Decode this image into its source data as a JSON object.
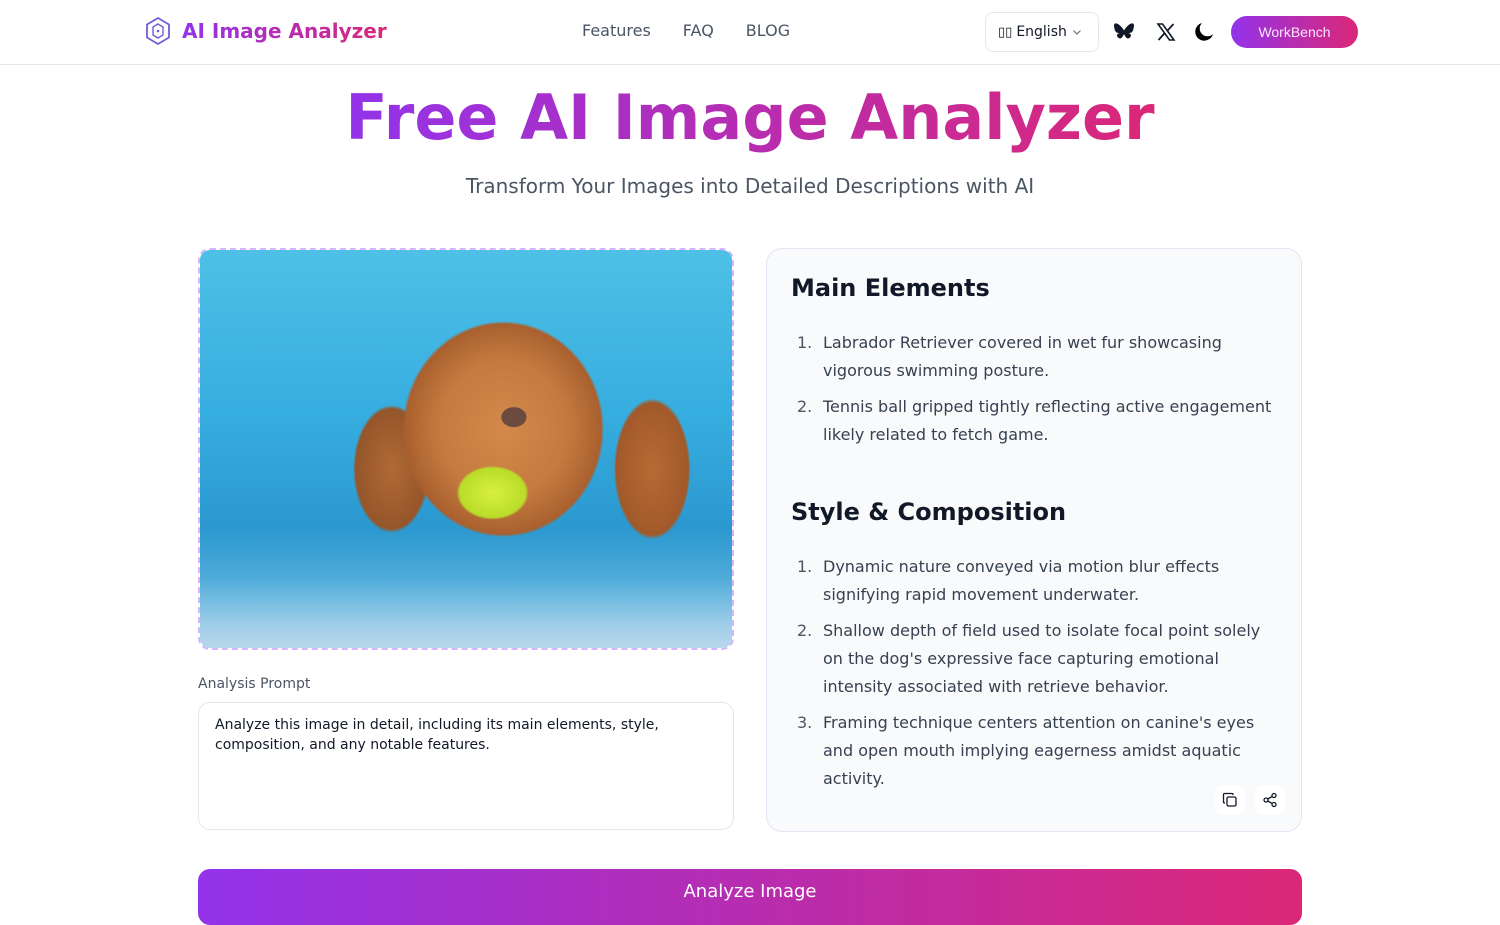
{
  "header": {
    "brand": "AI Image Analyzer",
    "nav": [
      {
        "label": "Features"
      },
      {
        "label": "FAQ"
      },
      {
        "label": "BLOG"
      }
    ],
    "language": {
      "flag": "🇺🇸",
      "selected": "English"
    },
    "icons": [
      "bluesky-icon",
      "x-icon",
      "moon-icon"
    ],
    "workbench_label": "WorkBench"
  },
  "hero": {
    "title": "Free AI Image Analyzer",
    "subtitle": "Transform Your Images into Detailed Descriptions with AI"
  },
  "upload": {
    "image_description": "Labrador retriever swimming in a pool with a tennis ball in its mouth"
  },
  "prompt": {
    "label": "Analysis Prompt",
    "value": "Analyze this image in detail, including its main elements, style, composition, and any notable features."
  },
  "result": {
    "sections": [
      {
        "heading": "Main Elements",
        "items": [
          {
            "num": "1.",
            "text": "Labrador Retriever covered in wet fur showcasing vigorous swimming posture."
          },
          {
            "num": "2.",
            "text": "Tennis ball gripped tightly reflecting active engagement likely related to fetch game."
          }
        ]
      },
      {
        "heading": "Style & Composition",
        "items": [
          {
            "num": "1.",
            "text": "Dynamic nature conveyed via motion blur effects signifying rapid movement underwater."
          },
          {
            "num": "2.",
            "text": "Shallow depth of field used to isolate focal point solely on the dog's expressive face capturing emotional intensity associated with retrieve behavior."
          },
          {
            "num": "3.",
            "text": "Framing technique centers attention on canine's eyes and open mouth implying eagerness amidst aquatic activity."
          }
        ]
      }
    ],
    "actions": [
      "copy-icon",
      "share-icon"
    ]
  },
  "analyze_button": {
    "label": "Analyze Image"
  },
  "colors": {
    "gradient_start": "#9333ea",
    "gradient_end": "#db2777",
    "upload_border": "#d8b4fe"
  }
}
